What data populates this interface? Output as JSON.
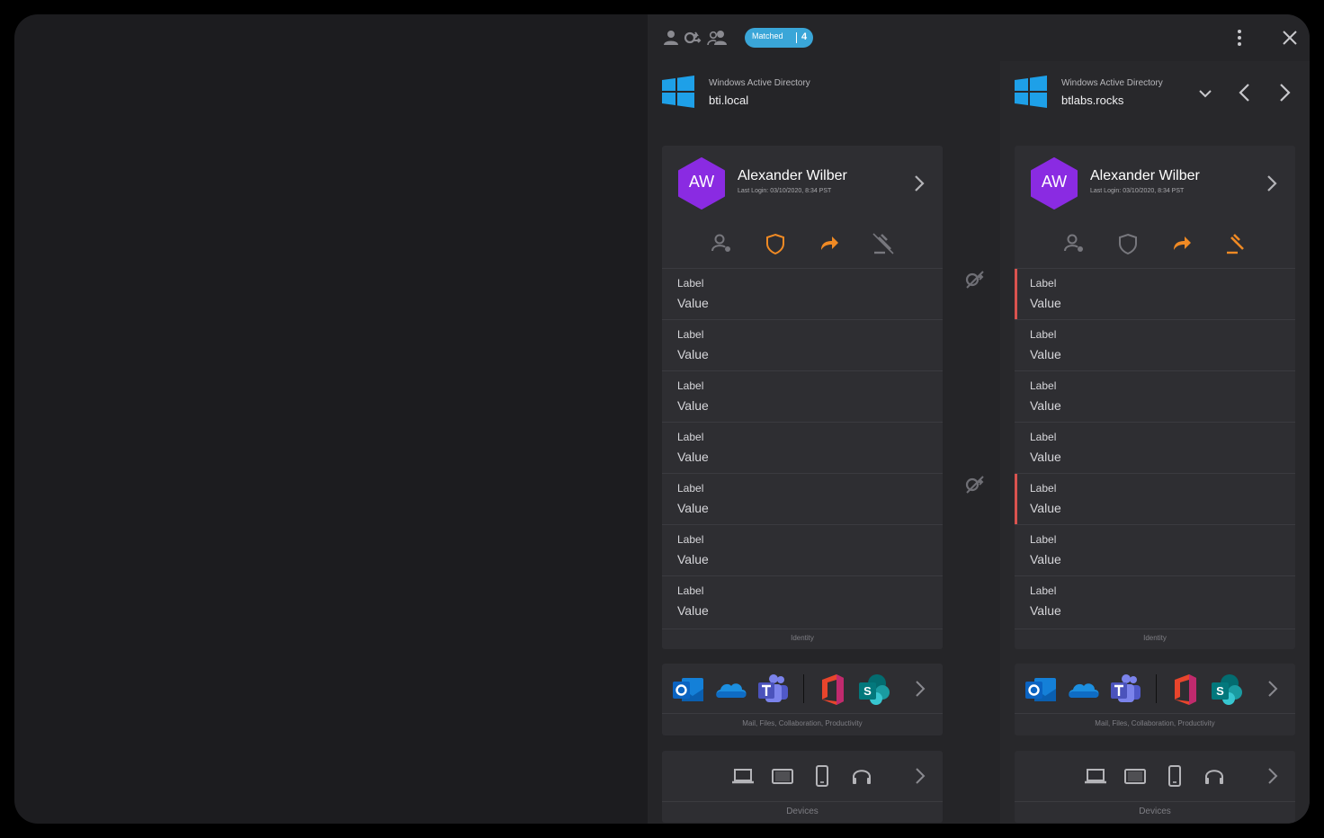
{
  "header": {
    "badge_label": "Matched",
    "badge_count": "4",
    "icons": [
      "user-icon",
      "unlink-icon",
      "users-icon",
      "more-vertical-icon",
      "close-icon"
    ]
  },
  "colors": {
    "accent_orange": "#f08a24",
    "badge_blue": "#3aa6d8",
    "avatar_purple": "#8a2be2",
    "diff_red": "#d9534f",
    "windows_blue": "#1ea0e8"
  },
  "left": {
    "directory_type": "Windows Active Directory",
    "directory_name": "bti.local",
    "user": {
      "initials": "AW",
      "name": "Alexander Wilber",
      "last_login": "Last Login: 03/10/2020, 8:34 PST"
    },
    "fields": [
      {
        "label": "Label",
        "value": "Value"
      },
      {
        "label": "Label",
        "value": "Value"
      },
      {
        "label": "Label",
        "value": "Value"
      },
      {
        "label": "Label",
        "value": "Value"
      },
      {
        "label": "Label",
        "value": "Value"
      },
      {
        "label": "Label",
        "value": "Value"
      },
      {
        "label": "Label",
        "value": "Value"
      }
    ],
    "identity_footer": "Identity",
    "apps_footer": "Mail, Files, Collaboration, Productivity",
    "devices_footer": "Devices"
  },
  "right": {
    "directory_type": "Windows Active Directory",
    "directory_name": "btlabs.rocks",
    "user": {
      "initials": "AW",
      "name": "Alexander Wilber",
      "last_login": "Last Login: 03/10/2020, 8:34 PST"
    },
    "fields": [
      {
        "label": "Label",
        "value": "Value"
      },
      {
        "label": "Label",
        "value": "Value"
      },
      {
        "label": "Label",
        "value": "Value"
      },
      {
        "label": "Label",
        "value": "Value"
      },
      {
        "label": "Label",
        "value": "Value"
      },
      {
        "label": "Label",
        "value": "Value"
      },
      {
        "label": "Label",
        "value": "Value"
      }
    ],
    "identity_footer": "Identity",
    "apps_footer": "Mail, Files, Collaboration, Productivity",
    "devices_footer": "Devices"
  }
}
